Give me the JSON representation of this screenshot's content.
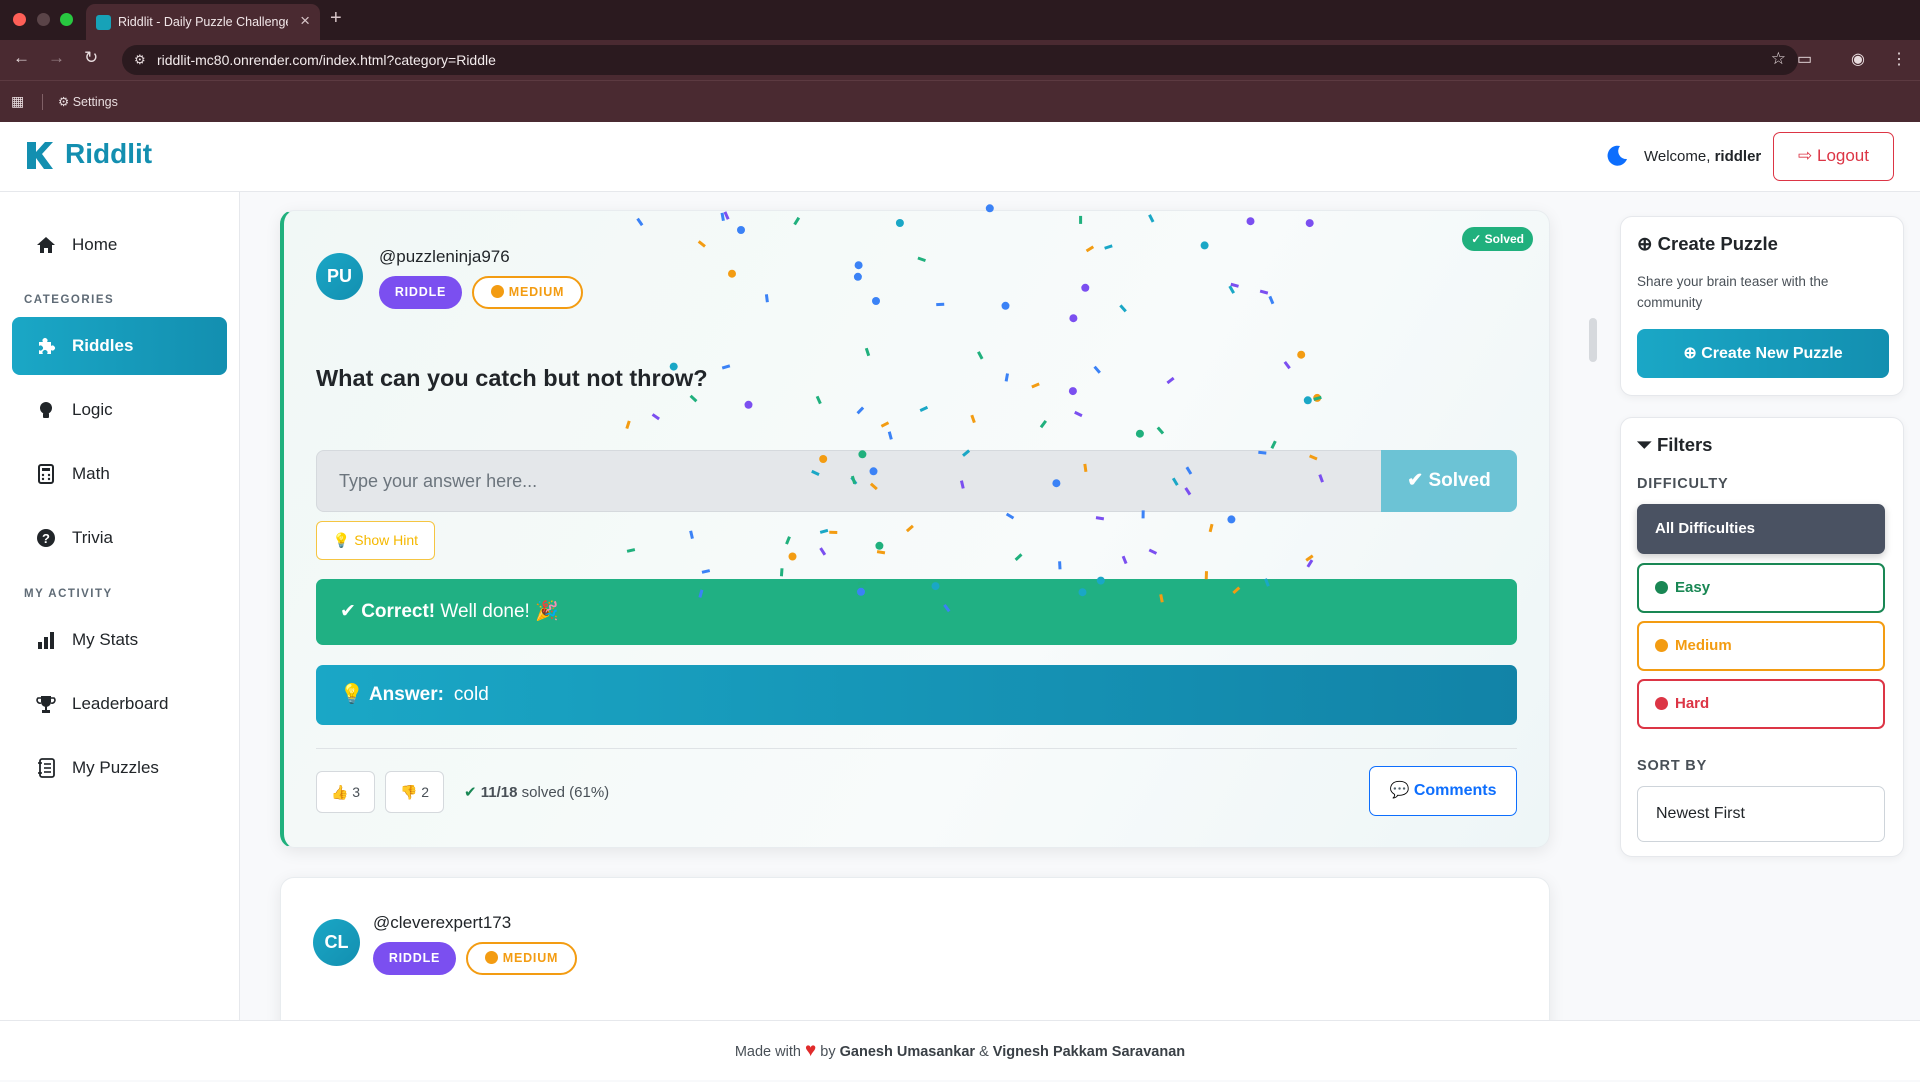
{
  "browser": {
    "tab_title": "Riddlit - Daily Puzzle Challenge",
    "url": "riddlit-mc80.onrender.com/index.html?category=Riddle",
    "bookmark_settings": "Settings"
  },
  "header": {
    "logo": "Riddlit",
    "welcome_prefix": "Welcome,",
    "username": "riddler",
    "logout": "Logout"
  },
  "sidebar": {
    "home": "Home",
    "categories_heading": "CATEGORIES",
    "categories": [
      {
        "label": "Riddles",
        "icon": "puzzle-icon",
        "active": true
      },
      {
        "label": "Logic",
        "icon": "lightbulb-icon",
        "active": false
      },
      {
        "label": "Math",
        "icon": "calculator-icon",
        "active": false
      },
      {
        "label": "Trivia",
        "icon": "question-circle-icon",
        "active": false
      }
    ],
    "activity_heading": "MY ACTIVITY",
    "activity": [
      {
        "label": "My Stats",
        "icon": "bar-chart-icon"
      },
      {
        "label": "Leaderboard",
        "icon": "trophy-icon"
      },
      {
        "label": "My Puzzles",
        "icon": "journal-icon"
      }
    ]
  },
  "puzzles": [
    {
      "avatar": "PU",
      "username": "@puzzleninja976",
      "category": "RIDDLE",
      "difficulty": "MEDIUM",
      "solved_badge": "✓ Solved",
      "question": "What can you catch but not throw?",
      "answer_placeholder": "Type your answer here...",
      "submit_label": "Solved",
      "hint_label": "Show Hint",
      "correct_title": "Correct!",
      "correct_text": "Well done! 🎉",
      "answer_label": "Answer:",
      "answer_value": "cold",
      "likes": "3",
      "dislikes": "2",
      "solved_count": "11/18",
      "solved_text": "solved (61%)",
      "comments_label": "Comments"
    },
    {
      "avatar": "CL",
      "username": "@cleverexpert173",
      "category": "RIDDLE",
      "difficulty": "MEDIUM"
    }
  ],
  "create_panel": {
    "title": "Create Puzzle",
    "description": "Share your brain teaser with the community",
    "button": "Create New Puzzle"
  },
  "filters": {
    "title": "Filters",
    "difficulty_heading": "DIFFICULTY",
    "options": [
      "All Difficulties",
      "Easy",
      "Medium",
      "Hard"
    ],
    "selected": "All Difficulties",
    "sort_heading": "SORT BY",
    "sort_value": "Newest First"
  },
  "footer": {
    "made_with": "Made with",
    "by": "by",
    "author1": "Ganesh Umasankar",
    "amp": "&",
    "author2": "Vignesh Pakkam Saravanan"
  },
  "colors": {
    "brand": "#138fb0",
    "success": "#20b083",
    "riddle_badge": "#7b4ff0",
    "medium": "#f39c12",
    "danger": "#dc3545"
  }
}
